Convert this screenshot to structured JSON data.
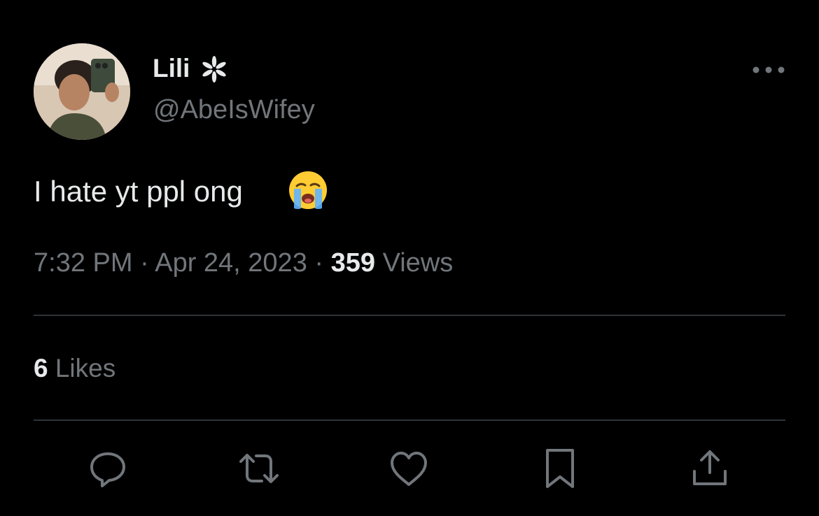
{
  "author": {
    "display_name": "Lili",
    "handle": "@AbeIsWifey",
    "badge_icon": "flower-icon"
  },
  "tweet": {
    "text": "I hate yt ppl ong",
    "emoji_icon": "loudly-crying-face-icon"
  },
  "meta": {
    "time": "7:32 PM",
    "separator": "·",
    "date": "Apr 24, 2023",
    "views_count": "359",
    "views_label": "Views"
  },
  "engagement": {
    "likes_count": "6",
    "likes_label": "Likes"
  },
  "actions": [
    {
      "name": "reply",
      "icon": "reply-icon"
    },
    {
      "name": "retweet",
      "icon": "retweet-icon"
    },
    {
      "name": "like",
      "icon": "heart-icon"
    },
    {
      "name": "bookmark",
      "icon": "bookmark-icon"
    },
    {
      "name": "share",
      "icon": "share-icon"
    }
  ],
  "colors": {
    "background": "#000000",
    "primary_text": "#e7e9ea",
    "secondary_text": "#71767b",
    "divider": "#2f3336"
  }
}
